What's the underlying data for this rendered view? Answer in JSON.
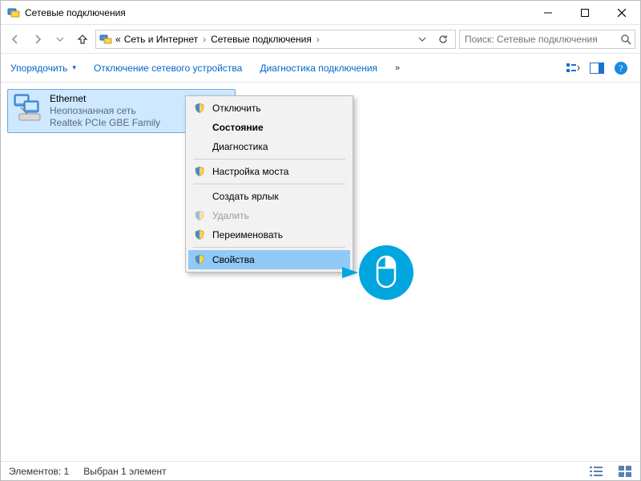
{
  "window": {
    "title": "Сетевые подключения"
  },
  "breadcrumb": {
    "root_prefix": "«",
    "part1": "Сеть и Интернет",
    "part2": "Сетевые подключения"
  },
  "search": {
    "placeholder": "Поиск: Сетевые подключения"
  },
  "commands": {
    "organize": "Упорядочить",
    "disable": "Отключение сетевого устройства",
    "diagnose": "Диагностика подключения",
    "overflow": "»"
  },
  "adapter": {
    "name": "Ethernet",
    "status": "Неопознанная сеть",
    "device": "Realtek PCIe GBE Family"
  },
  "context_menu": {
    "disable": "Отключить",
    "status": "Состояние",
    "diagnostics": "Диагностика",
    "bridge": "Настройка моста",
    "shortcut": "Создать ярлык",
    "delete": "Удалить",
    "rename": "Переименовать",
    "properties": "Свойства"
  },
  "statusbar": {
    "count_label": "Элементов: 1",
    "selection_label": "Выбран 1 элемент"
  },
  "colors": {
    "accent": "#0099d8",
    "selection": "#cde8ff",
    "link": "#0066cc"
  }
}
